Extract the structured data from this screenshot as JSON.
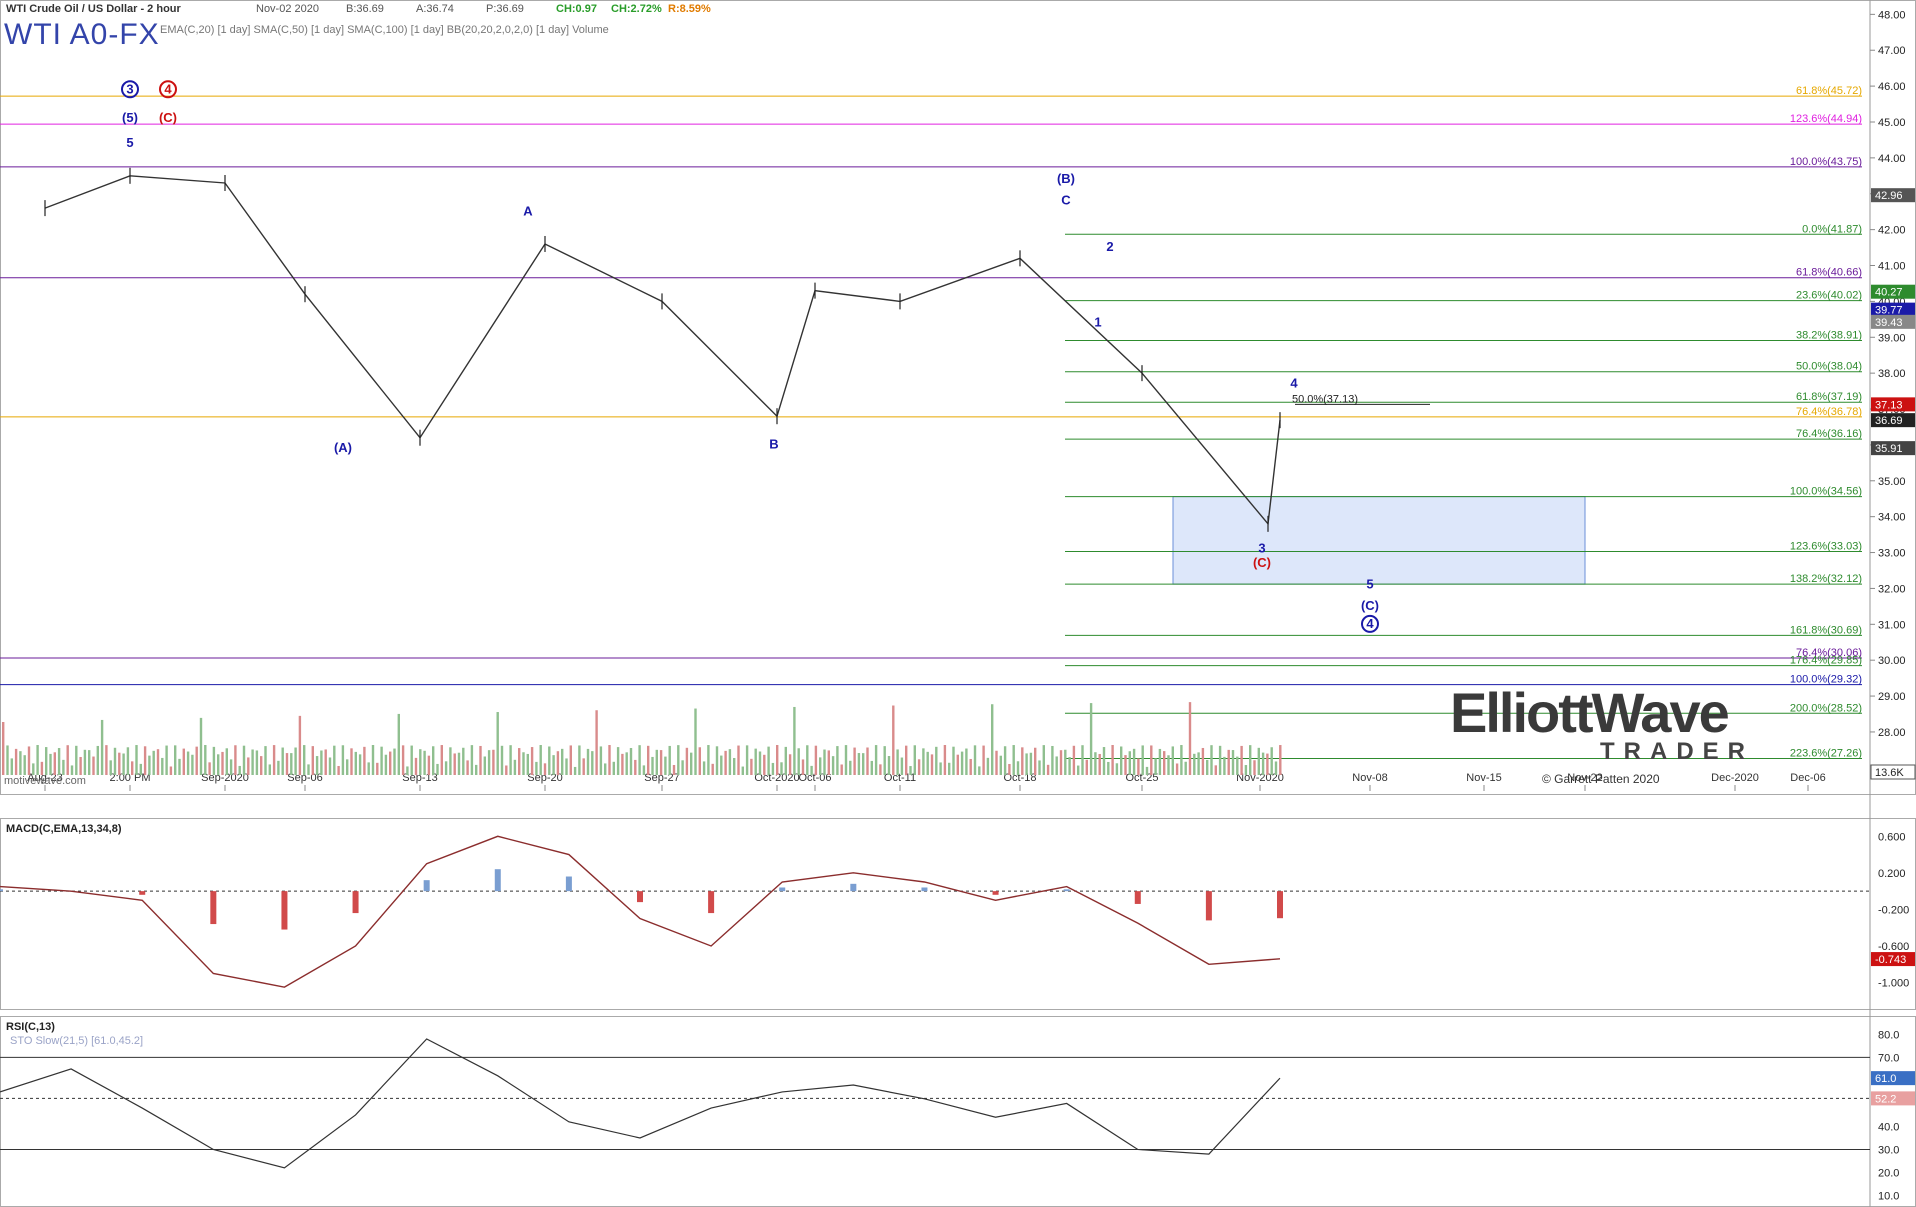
{
  "header": {
    "title": "WTI Crude Oil / US Dollar - 2 hour",
    "date": "Nov-02 2020",
    "bid": "B:36.69",
    "ask": "A:36.74",
    "price": "P:36.69",
    "change": "CH:0.97",
    "change_pct": "CH:2.72%",
    "range": "R:8.59%",
    "symbol": "WTI A0-FX",
    "indicators": "EMA(C,20) [1 day] SMA(C,50) [1 day] SMA(C,100) [1 day] BB(20,20,2,0,2,0) [1 day] Volume",
    "watermark": "motivewave.com"
  },
  "logo": {
    "line1": "ElliottWave",
    "line2": "TRADER",
    "copyright": "© Garrett Patten 2020"
  },
  "colors": {
    "wave_blue": "#1a1aa8",
    "wave_red": "#cc1111",
    "fib_green": "#2e8b2e",
    "fib_purple": "#6a1b9a",
    "fib_magenta": "#e020e0",
    "fib_orange": "#e6a800",
    "hist_pos": "#7a9ed1",
    "hist_neg": "#d14a4a",
    "target_box": "#dde7fa"
  },
  "chart_data": [
    {
      "type": "line",
      "title": "WTI Crude Oil / US Dollar - 2 hour",
      "x_ticks": [
        "Aug-23",
        "2:00 PM",
        "Sep-2020",
        "Sep-06",
        "Sep-13",
        "Sep-20",
        "Sep-27",
        "Oct-2020",
        "Oct-06",
        "Oct-11",
        "Oct-18",
        "Oct-25",
        "Nov-2020",
        "Nov-08",
        "Nov-15",
        "Nov-22",
        "Dec-2020",
        "Dec-06"
      ],
      "y_ticks": [
        "48.00",
        "47.00",
        "46.00",
        "45.00",
        "44.00",
        "43.00",
        "42.00",
        "41.00",
        "40.00",
        "39.00",
        "38.00",
        "37.00",
        "36.00",
        "35.00",
        "34.00",
        "33.00",
        "32.00",
        "31.00",
        "30.00",
        "29.00",
        "28.00"
      ],
      "ylim": [
        26.8,
        48.4
      ],
      "price_path": [
        {
          "x": "Aug-23",
          "y": 42.6
        },
        {
          "x": "2:00 PM",
          "y": 43.5
        },
        {
          "x": "Sep-2020",
          "y": 43.3
        },
        {
          "x": "Sep-06",
          "y": 40.2
        },
        {
          "x": "Sep-13",
          "y": 36.2
        },
        {
          "x": "Sep-20",
          "y": 41.6
        },
        {
          "x": "Sep-27",
          "y": 40.0
        },
        {
          "x": "Oct-2020",
          "y": 36.8
        },
        {
          "x": "Oct-06",
          "y": 40.3
        },
        {
          "x": "Oct-11",
          "y": 40.0
        },
        {
          "x": "Oct-18",
          "y": 41.2
        },
        {
          "x": "Oct-25",
          "y": 38.0
        },
        {
          "x": "Nov-2020",
          "y": 33.8
        },
        {
          "x": "Nov-2020",
          "y": 36.69
        }
      ],
      "price_labels": [
        {
          "value": 42.96,
          "text": "42.96",
          "color": "#555555"
        },
        {
          "value": 40.27,
          "text": "40.27",
          "color": "#2e8b2e"
        },
        {
          "value": 39.77,
          "text": "39.77",
          "color": "#1a1aa8"
        },
        {
          "value": 39.43,
          "text": "39.43",
          "color": "#888888"
        },
        {
          "value": 37.13,
          "text": "37.13",
          "color": "#cc1111"
        },
        {
          "value": 36.69,
          "text": "36.69",
          "color": "#222222"
        },
        {
          "value": 35.91,
          "text": "35.91",
          "color": "#444444"
        }
      ],
      "fib_levels": [
        {
          "label": "61.8%(45.72)",
          "value": 45.72,
          "color": "#e6a800"
        },
        {
          "label": "123.6%(44.94)",
          "value": 44.94,
          "color": "#e020e0"
        },
        {
          "label": "100.0%(43.75)",
          "value": 43.75,
          "color": "#6a1b9a"
        },
        {
          "label": "0.0%(41.87)",
          "value": 41.87,
          "color": "#2e8b2e"
        },
        {
          "label": "61.8%(40.66)",
          "value": 40.66,
          "color": "#6a1b9a"
        },
        {
          "label": "23.6%(40.02)",
          "value": 40.02,
          "color": "#2e8b2e"
        },
        {
          "label": "38.2%(38.91)",
          "value": 38.91,
          "color": "#2e8b2e"
        },
        {
          "label": "50.0%(38.04)",
          "value": 38.04,
          "color": "#2e8b2e"
        },
        {
          "label": "61.8%(37.19)",
          "value": 37.19,
          "color": "#2e8b2e"
        },
        {
          "label": "76.4%(36.78)",
          "value": 36.78,
          "color": "#e6a800"
        },
        {
          "label": "76.4%(36.16)",
          "value": 36.16,
          "color": "#2e8b2e"
        },
        {
          "label": "100.0%(34.56)",
          "value": 34.56,
          "color": "#2e8b2e"
        },
        {
          "label": "123.6%(33.03)",
          "value": 33.03,
          "color": "#2e8b2e"
        },
        {
          "label": "138.2%(32.12)",
          "value": 32.12,
          "color": "#2e8b2e"
        },
        {
          "label": "161.8%(30.69)",
          "value": 30.69,
          "color": "#2e8b2e"
        },
        {
          "label": "76.4%(30.06)",
          "value": 30.06,
          "color": "#6a1b9a"
        },
        {
          "label": "176.4%(29.85)",
          "value": 29.85,
          "color": "#2e8b2e"
        },
        {
          "label": "100.0%(29.32)",
          "value": 29.32,
          "color": "#1a1aa8"
        },
        {
          "label": "200.0%(28.52)",
          "value": 28.52,
          "color": "#2e8b2e"
        },
        {
          "label": "223.6%(27.26)",
          "value": 27.26,
          "color": "#2e8b2e"
        },
        {
          "label": "50.0%(37.13)",
          "value": 37.13,
          "color": "#222222"
        }
      ],
      "target_zone": {
        "top": 34.56,
        "bottom": 32.12
      },
      "volume_label": "13.6K",
      "wave_labels": [
        {
          "text": "3",
          "circled": true,
          "color": "#1a1aa8",
          "x": "2:00 PM",
          "y": 45.8
        },
        {
          "text": "(5)",
          "color": "#1a1aa8",
          "x": "2:00 PM",
          "y": 45.0
        },
        {
          "text": "5",
          "color": "#1a1aa8",
          "x": "2:00 PM",
          "y": 44.3
        },
        {
          "text": "4",
          "circled": true,
          "color": "#cc1111",
          "x": "2:00 PM",
          "y": 45.8
        },
        {
          "text": "(C)",
          "color": "#cc1111",
          "x": "2:00 PM",
          "y": 45.0
        },
        {
          "text": "(A)",
          "color": "#1a1aa8",
          "x": "Sep-06",
          "y": 35.8
        },
        {
          "text": "A",
          "color": "#1a1aa8",
          "x": "Sep-20",
          "y": 42.4
        },
        {
          "text": "B",
          "color": "#1a1aa8",
          "x": "Oct-2020",
          "y": 35.9
        },
        {
          "text": "(B)",
          "color": "#1a1aa8",
          "x": "Oct-18",
          "y": 43.3
        },
        {
          "text": "C",
          "color": "#1a1aa8",
          "x": "Oct-18",
          "y": 42.7
        },
        {
          "text": "1",
          "color": "#1a1aa8",
          "x": "Oct-18",
          "y": 39.3
        },
        {
          "text": "2",
          "color": "#1a1aa8",
          "x": "Oct-18",
          "y": 41.4
        },
        {
          "text": "3",
          "color": "#1a1aa8",
          "x": "Nov-2020",
          "y": 33.0
        },
        {
          "text": "(C)",
          "color": "#cc1111",
          "x": "Nov-2020",
          "y": 32.6
        },
        {
          "text": "4",
          "color": "#1a1aa8",
          "x": "Nov-2020",
          "y": 37.6
        },
        {
          "text": "5",
          "color": "#1a1aa8",
          "x": "Nov-08",
          "y": 32.0
        },
        {
          "text": "(C)",
          "color": "#1a1aa8",
          "x": "Nov-08",
          "y": 31.4
        },
        {
          "text": "4",
          "circled": true,
          "color": "#1a1aa8",
          "x": "Nov-08",
          "y": 30.9
        }
      ]
    },
    {
      "type": "line",
      "title": "MACD(C,EMA,13,34,8)",
      "y_ticks": [
        "0.600",
        "0.200",
        "-0.200",
        "-0.600",
        "-1.000"
      ],
      "ylim": [
        -1.3,
        0.8
      ],
      "last_value": "-0.743",
      "series": [
        {
          "name": "MACD",
          "values": [
            0.05,
            0.0,
            -0.1,
            -0.9,
            -1.05,
            -0.6,
            0.3,
            0.6,
            0.4,
            -0.3,
            -0.6,
            0.1,
            0.2,
            0.1,
            -0.1,
            0.05,
            -0.35,
            -0.8,
            -0.74
          ]
        }
      ]
    },
    {
      "type": "line",
      "title": "RSI(C,13)",
      "subtitle": "STO Slow(21,5) [61.0,45.2]",
      "y_ticks": [
        "80.0",
        "70.0",
        "60.0",
        "40.0",
        "30.0",
        "20.0",
        "10.0"
      ],
      "ylim": [
        5,
        88
      ],
      "levels": [
        70,
        30
      ],
      "series": [
        {
          "name": "RSI",
          "values": [
            55,
            65,
            48,
            30,
            22,
            45,
            78,
            62,
            42,
            35,
            48,
            55,
            58,
            52,
            44,
            50,
            30,
            28,
            61.0
          ]
        }
      ],
      "last_values": [
        "61.0",
        "52.2"
      ]
    }
  ]
}
